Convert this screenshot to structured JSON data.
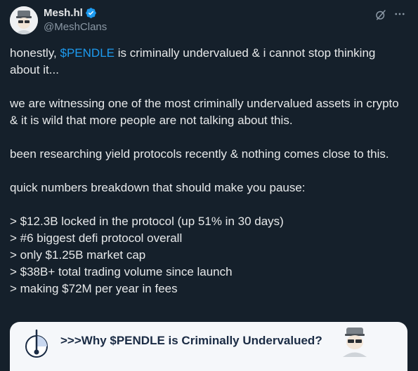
{
  "author": {
    "display_name": "Mesh.hl",
    "handle": "@MeshClans",
    "verified": true,
    "avatar_icon": "cartoon-avatar"
  },
  "header_actions": {
    "grok_icon": "grok-icon",
    "more_icon": "more-horizontal-icon"
  },
  "tweet": {
    "line1_before": "honestly, ",
    "cashtag": "$PENDLE",
    "line1_after": " is criminally undervalued & i cannot stop thinking about it...",
    "para2": "we are witnessing one of the most criminally undervalued assets in crypto & it is wild that more people are not talking about this.",
    "para3": "been researching yield protocols recently & nothing comes close to this.",
    "para4": "quick numbers breakdown that should make you pause:",
    "bullets": [
      "> $12.3B locked in the protocol (up 51% in 30 days)",
      "> #6 biggest defi protocol overall",
      "> only $1.25B market cap",
      "> $38B+ total trading volume since launch",
      "> making $72M per year in fees"
    ]
  },
  "card": {
    "title": ">>>Why $PENDLE is Criminally Undervalued?",
    "logo_icon": "pendle-logo-icon",
    "avatar_icon": "cartoon-avatar"
  },
  "colors": {
    "background": "#15202b",
    "text": "#e7e9ea",
    "muted": "#8b98a5",
    "link": "#1d9bf0",
    "card_bg": "#f5f7fa",
    "card_title": "#1a2b44"
  }
}
